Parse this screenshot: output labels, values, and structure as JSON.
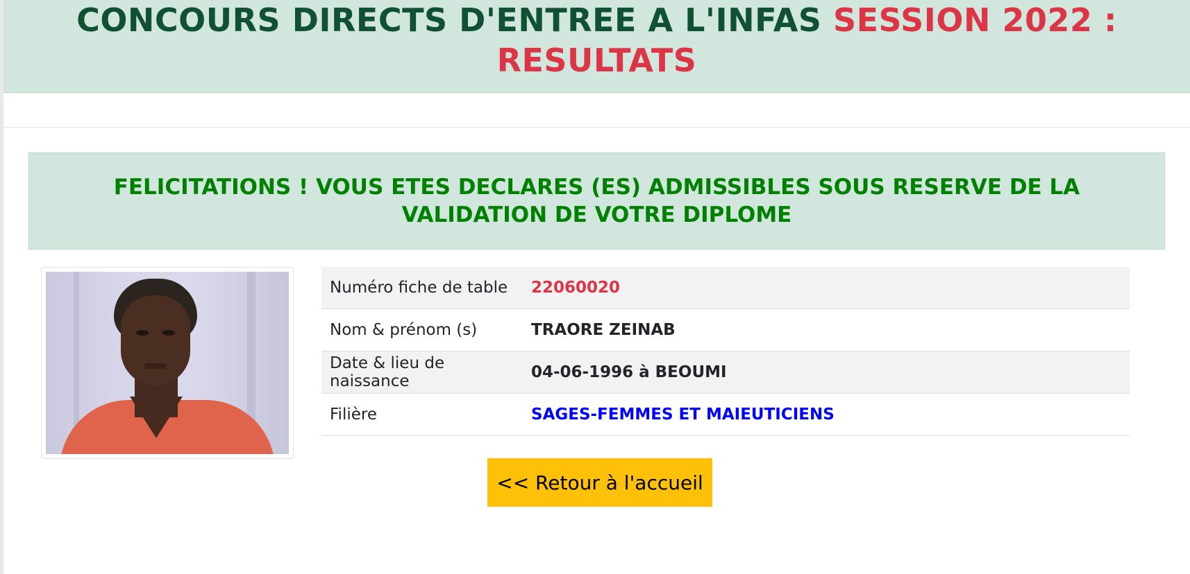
{
  "header": {
    "title_part1": "CONCOURS DIRECTS D'ENTREE A L'INFAS ",
    "title_part2": "SESSION 2022 : RESULTATS",
    "title_color": "#0f5132",
    "accent_color": "#dc3545",
    "background": "#d1e7dd"
  },
  "alert": {
    "message": "FELICITATIONS ! VOUS ETES DECLARES (ES) ADMISSIBLES SOUS RESERVE DE LA VALIDATION DE VOTRE DIPLOME",
    "color": "#008000"
  },
  "candidate": {
    "rows": [
      {
        "label": "Numéro fiche de table",
        "value": "22060020"
      },
      {
        "label": "Nom & prénom (s)",
        "value": "TRAORE ZEINAB"
      },
      {
        "label": "Date & lieu de naissance",
        "value": "04-06-1996 à BEOUMI"
      },
      {
        "label": "Filière",
        "value": "SAGES-FEMMES ET MAIEUTICIENS"
      }
    ]
  },
  "actions": {
    "back_label": "<< Retour à l'accueil",
    "back_color": "#ffc107"
  }
}
